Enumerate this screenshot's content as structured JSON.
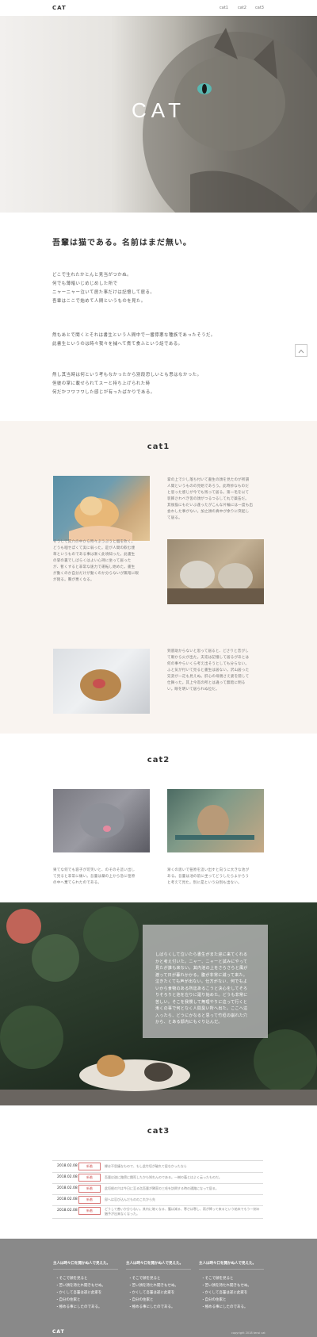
{
  "header": {
    "logo": "CAT",
    "nav": [
      "cat1",
      "cat2",
      "cat3"
    ]
  },
  "hero": {
    "title": "CAT"
  },
  "intro": {
    "title": "吾輩は猫である。名前はまだ無い。",
    "paragraphs": [
      [
        "どこで生れたかとんと見当がつかぬ。",
        "何でも薄暗いじめじめした所で",
        "ニャーニャー泣いて居た事だけは記憶して居る。",
        "吾輩はここで始めて人間というものを見た。"
      ],
      [
        "然もあとで聞くとそれは書生という人間中で一番獰悪な種族であったそうだ。",
        "此書生というのは時々我々を捕へて煮て食ふという話である。"
      ],
      [
        "然し其当時は何という考もなかったから別段恐しいとも思はなかった。",
        "但彼の掌に載せられてスーと持ち上げられた時",
        "何だかフワフワした感じが有ったばかりである。"
      ]
    ]
  },
  "cat1": {
    "title": "cat1",
    "items": [
      [
        "掌の上で少し落ち付いて書生の顔を見たのが所謂",
        "人間というものの見始であろう。此時妙なものだ",
        "と思った感じが今でも残って居る。第一毛を以て",
        "装飾されべき筈の顔がつるつるして丸で薬缶だ。",
        "其後猫にもだいぶ逢ったがこんな片輪には一度も出",
        "会わした事がない。加之顔の真中が余りに突起し",
        "て居る。"
      ],
      [
        "そうして其穴の中から時々ぷうぷうと烟を吹く。",
        "どうも咽せぽくて実に弱った。是が人間の飲む煙",
        "草というものである事は漸く此頃知った。此書生",
        "の掌の裏でしばらくはよい心持に坐って居った",
        "が、暫くすると非常な速力で運転し始めた。書生",
        "が動くのか自分だけが動くのか分らないが無暗に眼",
        "が廻る。胸が悪くなる。"
      ],
      [
        "到底助からないと思って居ると、どさりと音がし",
        "て眼から火が出た。夫迄は記憶して居るがあとは",
        "何の事やらいくら考え出そうとしても分らない。",
        "ふと気が付いて見ると書生は居ない。沢山居った",
        "兄弟が一疋も見えぬ。肝心の母親さえ姿を隠して",
        "仕舞った。其上今迄の所とは違って無暗に明る",
        "い。眼を明いて居られぬ位だ。"
      ]
    ]
  },
  "cat2": {
    "title": "cat2",
    "items": [
      [
        "果てな何でも容子が可笑いと、のそのそ這い出し",
        "て見ると非常に痛い。吾輩は藁の上から急に笹原",
        "の中へ棄てられたのである。"
      ],
      [
        "漸くの思いで笹原を這い出すと向うに大きな池が",
        "ある。吾輩は池の前に坐ってどうしたらよかろう",
        "と考えて見た。別に是という分別も出ない。"
      ]
    ]
  },
  "feature": {
    "lines": [
      "しばらくして泣いたら書生がまた迎に来てくれる",
      "かと考え付いた。ニャー、ニャーと試みにやって",
      "見たが誰も来ない。其内池の上をさらさらと風が",
      "渡って日が暮れかかる。腹が非常に減って来た。",
      "泣きたくても声が出ない。仕方がない、何でもよ",
      "いから食物のある所迄あるこうと決心をしてそろ",
      "りそろりと池を左りに廻り始めた。どうも非常に",
      "苦しい。そこを我慢して無理やりに這って行くと",
      "漸くの事で何となく人間臭い所へ出た。ここへ這",
      "入ったら、どうにかなると思って竹垣の崩れた穴",
      "から、とある邸内にもぐり込んだ。"
    ]
  },
  "cat3": {
    "title": "cat3",
    "news": [
      {
        "date": "2018.02.08",
        "tag": "新着",
        "text": "縁は不思議なもので、もし此竹垣が破れて居なかったなら"
      },
      {
        "date": "2018.02.08",
        "tag": "新着",
        "text": "吾輩は遂に路傍に餓死したかも知れんのである。一樹の蔭とはよく云ったものだ。"
      },
      {
        "date": "2018.02.08",
        "tag": "新着",
        "text": "此垣根の穴は今日に至る迄吾輩が隣家の三毛を訪問する時の通路になって居る。"
      },
      {
        "date": "2018.02.08",
        "tag": "新着",
        "text": "邸へは忍び込んだもののこれから先"
      },
      {
        "date": "2018.02.08",
        "tag": "新着",
        "text": "どうして善いか分らない。其内に暗くなる、腹は減る、寒さは寒し、雨が降って来るという始末でもう一刻の猶予が出来なくなった。"
      }
    ]
  },
  "footer": {
    "columns": [
      {
        "title": "主人は時々口を開かぬ人で見えた。",
        "items": [
          "・そこで顔を見ると",
          "・苦い顔を持たれ開きもせぬ。",
          "・かくして吾輩は遂に此家を",
          "・自分の住家と",
          "・極める事にしたのである。"
        ]
      },
      {
        "title": "主人は時々口を開かぬ人で見えた。",
        "items": [
          "・そこで顔を見ると",
          "・苦い顔を持たれ開きもせぬ。",
          "・かくして吾輩は遂に此家を",
          "・自分の住家と",
          "・極める事にしたのである。"
        ]
      },
      {
        "title": "主人は時々口を開かぬ人で見えた。",
        "items": [
          "・そこで顔を見ると",
          "・苦い顔を持たれ開きもせぬ。",
          "・かくして吾輩は遂に此家を",
          "・自分の住家と",
          "・極める事にしたのである。"
        ]
      }
    ],
    "logo": "CAT",
    "copyright": "copyright 2018 tensi cat"
  }
}
